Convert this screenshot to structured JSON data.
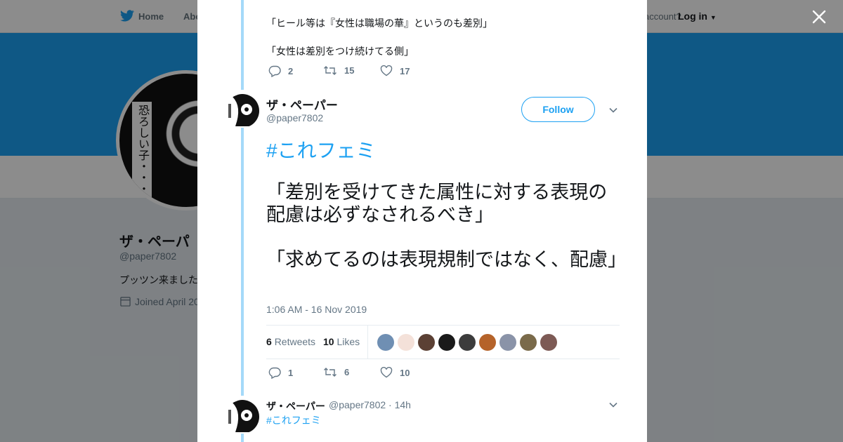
{
  "background_page": {
    "nav": {
      "home": "Home",
      "about": "Abo",
      "account": "account?",
      "login": "Log in"
    },
    "avatar_text": "恐ろしい子・・・!",
    "name": "ザ・ペーパ",
    "handle": "@paper7802",
    "bio": "プッツン来ました",
    "joined": "Joined April 20"
  },
  "modal": {
    "prev_tweet": {
      "lines": [
        "「ヒール等は『女性は職場の華』というのも差別」",
        "「女性は差別をつけ続けてる側」"
      ],
      "replies": "2",
      "retweets": "15",
      "likes": "17"
    },
    "main_tweet": {
      "name": "ザ・ペーパー",
      "handle": "@paper7802",
      "follow_label": "Follow",
      "hashtag": "#これフェミ",
      "paragraph1": "「差別を受けてきた属性に対する表現の配慮は必ずなされるべき」",
      "paragraph2": "「求めてるのは表現規制ではなく、配慮」",
      "timestamp": "1:06 AM - 16 Nov 2019",
      "retweet_count": "6",
      "retweet_label": "Retweets",
      "like_count": "10",
      "like_label": "Likes",
      "replies": "1",
      "retweets": "6",
      "likes": "10"
    },
    "reply_tweet": {
      "name": "ザ・ペーパー",
      "meta": "@paper7802 · 14h",
      "hashtag": "#これフェミ"
    }
  },
  "colors": {
    "accent": "#1da1f2",
    "thread": "#a4d9f9",
    "muted": "#657786"
  }
}
